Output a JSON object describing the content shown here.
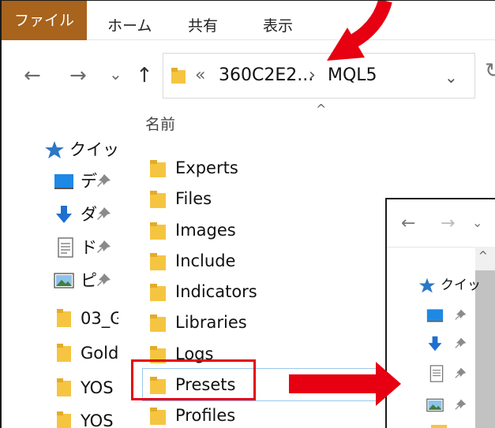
{
  "ribbon": {
    "tabs": [
      "ファイル",
      "ホーム",
      "共有",
      "表示"
    ]
  },
  "nav": {
    "back": "←",
    "forward": "→",
    "recent": "⌄",
    "up": "↑"
  },
  "address": {
    "overflow": "«",
    "segments": [
      "360C2E2...",
      "MQL5"
    ],
    "separator": "›",
    "dropdown": "⌄"
  },
  "sidebar": {
    "items": [
      {
        "label": "クイック",
        "icon": "star-icon"
      },
      {
        "label": "デ",
        "icon": "desktop-icon"
      },
      {
        "label": "ダ",
        "icon": "download-icon"
      },
      {
        "label": "ド",
        "icon": "document-icon"
      },
      {
        "label": "ピ",
        "icon": "picture-icon"
      },
      {
        "label": "03_G",
        "icon": "folder-icon"
      },
      {
        "label": "Gold",
        "icon": "folder-icon"
      },
      {
        "label": "YOS",
        "icon": "folder-icon"
      },
      {
        "label": "YOS",
        "icon": "folder-icon"
      }
    ]
  },
  "list": {
    "column_header": "名前",
    "sort_indicator": "^",
    "rows": [
      "Experts",
      "Files",
      "Images",
      "Include",
      "Indicators",
      "Libraries",
      "Logs",
      "Presets",
      "Profiles"
    ],
    "highlighted": "Presets"
  },
  "window2": {
    "nav": [
      "←",
      "→",
      "⌄"
    ],
    "items": [
      {
        "label": "クイッ",
        "icon": "star-icon"
      },
      {
        "label": "",
        "icon": "desktop-icon"
      },
      {
        "label": "",
        "icon": "download-icon"
      },
      {
        "label": "",
        "icon": "document-icon"
      },
      {
        "label": "",
        "icon": "picture-icon"
      }
    ]
  },
  "colors": {
    "file_tab": "#a8631d",
    "folder": "#f5c542",
    "annotation_red": "#e60012",
    "selection_border": "#99c8ee"
  }
}
